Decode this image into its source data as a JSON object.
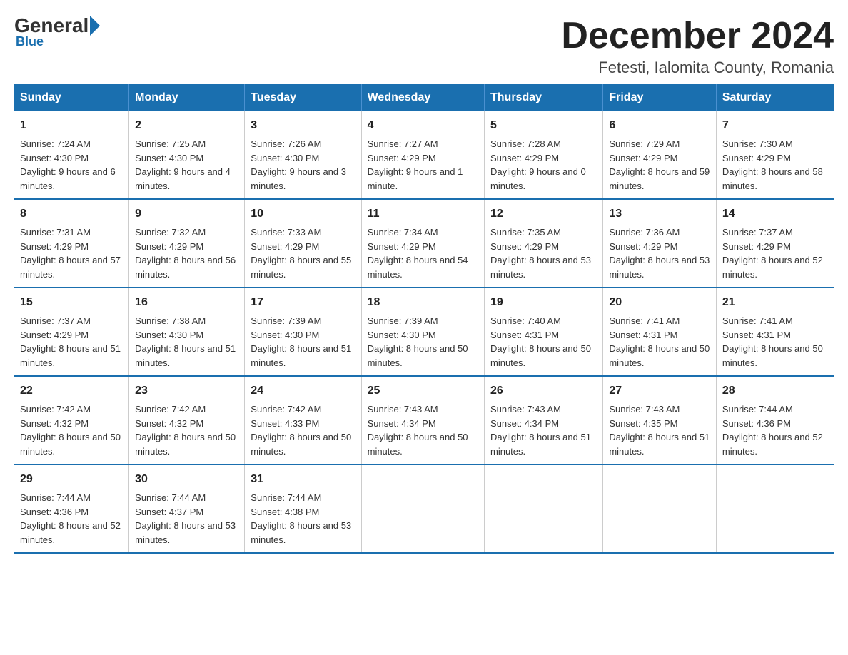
{
  "header": {
    "logo_general": "General",
    "logo_blue": "Blue",
    "title": "December 2024",
    "subtitle": "Fetesti, Ialomita County, Romania"
  },
  "days_of_week": [
    "Sunday",
    "Monday",
    "Tuesday",
    "Wednesday",
    "Thursday",
    "Friday",
    "Saturday"
  ],
  "weeks": [
    [
      {
        "day": "1",
        "sunrise": "7:24 AM",
        "sunset": "4:30 PM",
        "daylight": "9 hours and 6 minutes."
      },
      {
        "day": "2",
        "sunrise": "7:25 AM",
        "sunset": "4:30 PM",
        "daylight": "9 hours and 4 minutes."
      },
      {
        "day": "3",
        "sunrise": "7:26 AM",
        "sunset": "4:30 PM",
        "daylight": "9 hours and 3 minutes."
      },
      {
        "day": "4",
        "sunrise": "7:27 AM",
        "sunset": "4:29 PM",
        "daylight": "9 hours and 1 minute."
      },
      {
        "day": "5",
        "sunrise": "7:28 AM",
        "sunset": "4:29 PM",
        "daylight": "9 hours and 0 minutes."
      },
      {
        "day": "6",
        "sunrise": "7:29 AM",
        "sunset": "4:29 PM",
        "daylight": "8 hours and 59 minutes."
      },
      {
        "day": "7",
        "sunrise": "7:30 AM",
        "sunset": "4:29 PM",
        "daylight": "8 hours and 58 minutes."
      }
    ],
    [
      {
        "day": "8",
        "sunrise": "7:31 AM",
        "sunset": "4:29 PM",
        "daylight": "8 hours and 57 minutes."
      },
      {
        "day": "9",
        "sunrise": "7:32 AM",
        "sunset": "4:29 PM",
        "daylight": "8 hours and 56 minutes."
      },
      {
        "day": "10",
        "sunrise": "7:33 AM",
        "sunset": "4:29 PM",
        "daylight": "8 hours and 55 minutes."
      },
      {
        "day": "11",
        "sunrise": "7:34 AM",
        "sunset": "4:29 PM",
        "daylight": "8 hours and 54 minutes."
      },
      {
        "day": "12",
        "sunrise": "7:35 AM",
        "sunset": "4:29 PM",
        "daylight": "8 hours and 53 minutes."
      },
      {
        "day": "13",
        "sunrise": "7:36 AM",
        "sunset": "4:29 PM",
        "daylight": "8 hours and 53 minutes."
      },
      {
        "day": "14",
        "sunrise": "7:37 AM",
        "sunset": "4:29 PM",
        "daylight": "8 hours and 52 minutes."
      }
    ],
    [
      {
        "day": "15",
        "sunrise": "7:37 AM",
        "sunset": "4:29 PM",
        "daylight": "8 hours and 51 minutes."
      },
      {
        "day": "16",
        "sunrise": "7:38 AM",
        "sunset": "4:30 PM",
        "daylight": "8 hours and 51 minutes."
      },
      {
        "day": "17",
        "sunrise": "7:39 AM",
        "sunset": "4:30 PM",
        "daylight": "8 hours and 51 minutes."
      },
      {
        "day": "18",
        "sunrise": "7:39 AM",
        "sunset": "4:30 PM",
        "daylight": "8 hours and 50 minutes."
      },
      {
        "day": "19",
        "sunrise": "7:40 AM",
        "sunset": "4:31 PM",
        "daylight": "8 hours and 50 minutes."
      },
      {
        "day": "20",
        "sunrise": "7:41 AM",
        "sunset": "4:31 PM",
        "daylight": "8 hours and 50 minutes."
      },
      {
        "day": "21",
        "sunrise": "7:41 AM",
        "sunset": "4:31 PM",
        "daylight": "8 hours and 50 minutes."
      }
    ],
    [
      {
        "day": "22",
        "sunrise": "7:42 AM",
        "sunset": "4:32 PM",
        "daylight": "8 hours and 50 minutes."
      },
      {
        "day": "23",
        "sunrise": "7:42 AM",
        "sunset": "4:32 PM",
        "daylight": "8 hours and 50 minutes."
      },
      {
        "day": "24",
        "sunrise": "7:42 AM",
        "sunset": "4:33 PM",
        "daylight": "8 hours and 50 minutes."
      },
      {
        "day": "25",
        "sunrise": "7:43 AM",
        "sunset": "4:34 PM",
        "daylight": "8 hours and 50 minutes."
      },
      {
        "day": "26",
        "sunrise": "7:43 AM",
        "sunset": "4:34 PM",
        "daylight": "8 hours and 51 minutes."
      },
      {
        "day": "27",
        "sunrise": "7:43 AM",
        "sunset": "4:35 PM",
        "daylight": "8 hours and 51 minutes."
      },
      {
        "day": "28",
        "sunrise": "7:44 AM",
        "sunset": "4:36 PM",
        "daylight": "8 hours and 52 minutes."
      }
    ],
    [
      {
        "day": "29",
        "sunrise": "7:44 AM",
        "sunset": "4:36 PM",
        "daylight": "8 hours and 52 minutes."
      },
      {
        "day": "30",
        "sunrise": "7:44 AM",
        "sunset": "4:37 PM",
        "daylight": "8 hours and 53 minutes."
      },
      {
        "day": "31",
        "sunrise": "7:44 AM",
        "sunset": "4:38 PM",
        "daylight": "8 hours and 53 minutes."
      },
      null,
      null,
      null,
      null
    ]
  ],
  "labels": {
    "sunrise_prefix": "Sunrise: ",
    "sunset_prefix": "Sunset: ",
    "daylight_prefix": "Daylight: "
  }
}
